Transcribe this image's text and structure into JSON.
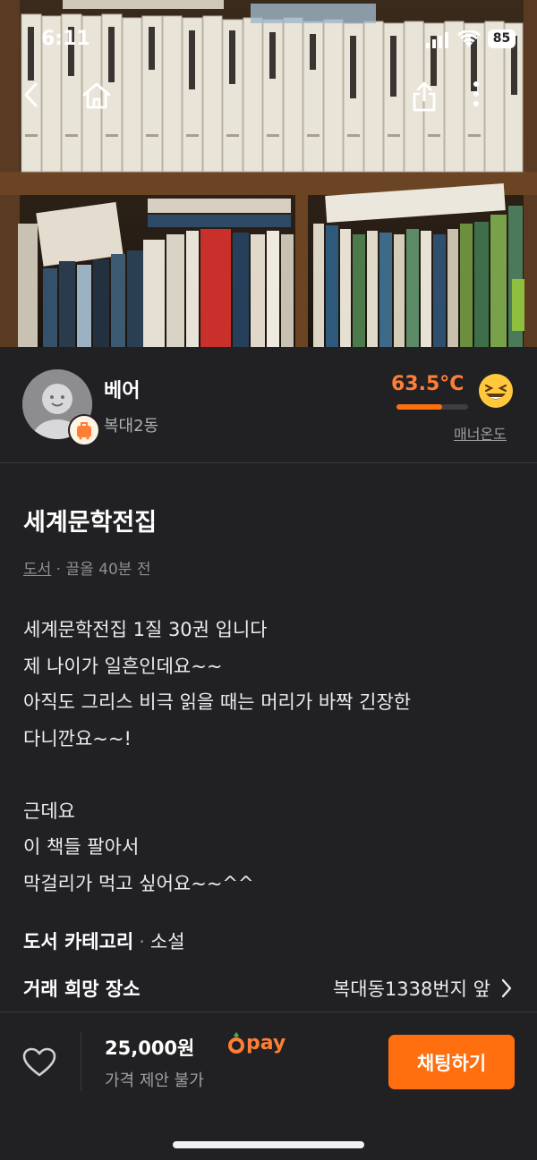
{
  "status_bar": {
    "time": "6:11",
    "battery": "85"
  },
  "nav": {
    "back_icon": "chevron-left-icon",
    "home_icon": "home-icon",
    "share_icon": "share-icon",
    "more_icon": "more-vertical-icon"
  },
  "seller": {
    "name": "베어",
    "location": "복대2동",
    "temperature": "63.5°C",
    "temperature_level": 0.635,
    "manner_label": "매너온도",
    "temp_color": "#ff7e36"
  },
  "post": {
    "title": "세계문학전집",
    "category": "도서",
    "meta_rest": " · 끌올 40분 전",
    "description": [
      "세계문학전집 1질 30권 입니다",
      "제 나이가  일흔인데요~~",
      "아직도  그리스 비극 읽을 때는 머리가 바짝 긴장한",
      "다니깐요~~!",
      "",
      "근데요",
      "이 책들  팔아서",
      "막걸리가 먹고 싶어요~~^^"
    ],
    "book_category_label": "도서 카테고리",
    "book_category_value": "소설",
    "place_label": "거래 희망 장소",
    "place_value": "복대동1338번지 앞"
  },
  "bottom_bar": {
    "price": "25,000원",
    "pay_label": "pay",
    "negotiation": "가격 제안 불가",
    "chat_button": "채팅하기",
    "accent": "#ff6f0f"
  }
}
